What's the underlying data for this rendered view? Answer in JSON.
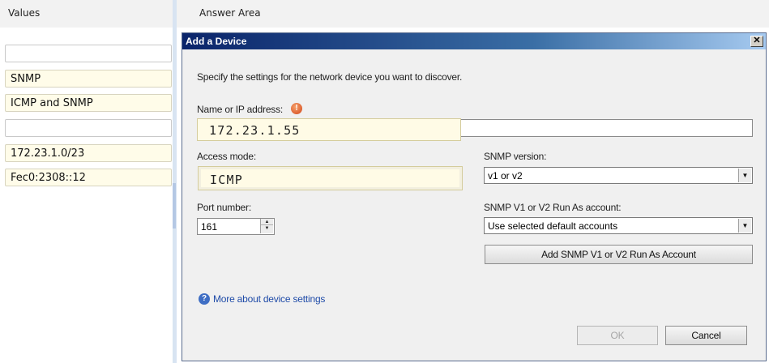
{
  "values_panel": {
    "title": "Values",
    "items": [
      "",
      "SNMP",
      "ICMP and SNMP",
      "",
      "172.23.1.0/23",
      "Fec0:2308::12"
    ]
  },
  "answer_area": {
    "title": "Answer Area"
  },
  "dialog": {
    "title": "Add a Device",
    "close_label": "✕",
    "intro": "Specify the settings for the network device you want to discover.",
    "name_label": "Name or IP address:",
    "required_icon": "!",
    "name_answer": "172.23.1.55",
    "name_value": "",
    "access_mode_label": "Access mode:",
    "access_mode_answer": "ICMP",
    "snmp_version_label": "SNMP version:",
    "snmp_version_value": "v1 or v2",
    "port_label": "Port number:",
    "port_value": "161",
    "run_as_label": "SNMP V1 or V2 Run As account:",
    "run_as_value": "Use selected default accounts",
    "add_account_button": "Add SNMP V1 or V2 Run As Account",
    "help_icon": "?",
    "more_link": "More about device settings",
    "ok_button": "OK",
    "cancel_button": "Cancel"
  },
  "icons": {
    "required": "exclamation-icon",
    "help": "help-icon",
    "dropdown": "chevron-down-icon",
    "close": "close-icon"
  },
  "colors": {
    "titlebar_start": "#0a246a",
    "titlebar_end": "#a6caf0",
    "answer_slot": "#fffbe6",
    "link": "#1f4ba8"
  }
}
